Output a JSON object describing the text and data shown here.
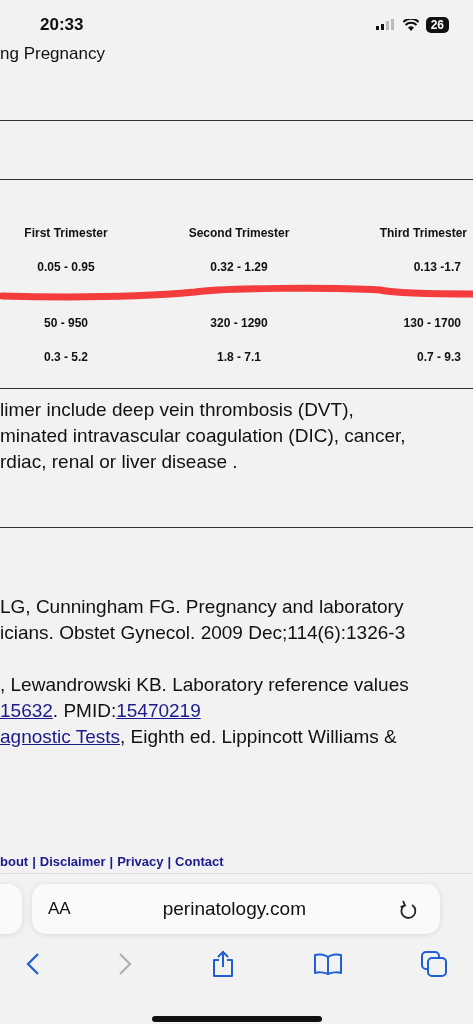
{
  "status_bar": {
    "time": "20:33",
    "battery": "26"
  },
  "page": {
    "heading_fragment": "ng Pregnancy",
    "table": {
      "columns": [
        "First Trimester",
        "Second Trimester",
        "Third Trimester"
      ],
      "rows": [
        [
          "0.05 - 0.95",
          "0.32 - 1.29",
          "0.13 -1.7"
        ],
        [
          "50 - 950",
          "320 - 1290",
          "130 - 1700"
        ],
        [
          "0.3 - 5.2",
          "1.8 - 7.1",
          "0.7 - 9.3"
        ]
      ]
    },
    "paragraph_lines": [
      "limer include deep vein thrombosis (DVT),",
      "minated intravascular coagulation (DIC), cancer,",
      "rdiac, renal or liver disease ."
    ],
    "references": [
      {
        "lines": [
          [
            {
              "text": "LG, Cunningham FG. Pregnancy and laboratory",
              "link": false
            }
          ],
          [
            {
              "text": "icians. Obstet Gynecol. 2009 Dec;114(6):1326-3",
              "link": false
            }
          ]
        ]
      },
      {
        "lines": [
          [
            {
              "text": ", Lewandrowski KB. Laboratory reference values",
              "link": false
            }
          ],
          [
            {
              "text": "15632",
              "link": true
            },
            {
              "text": ". PMID:",
              "link": false
            },
            {
              "text": "15470219",
              "link": true
            }
          ],
          [
            {
              "text": "agnostic Tests",
              "link": true
            },
            {
              "text": ", Eighth ed. Lippincott Williams &",
              "link": false
            }
          ]
        ]
      }
    ],
    "footer": {
      "links": [
        "bout",
        "Disclaimer",
        "Privacy",
        "Contact"
      ],
      "separator": "|"
    }
  },
  "browser": {
    "text_size_button": "AA",
    "url": "perinatology.com",
    "toolbar": [
      {
        "kind": "back",
        "disabled": false
      },
      {
        "kind": "forward",
        "disabled": true
      },
      {
        "kind": "share",
        "disabled": false
      },
      {
        "kind": "bookmarks",
        "disabled": false
      },
      {
        "kind": "tabs",
        "disabled": false
      }
    ]
  }
}
